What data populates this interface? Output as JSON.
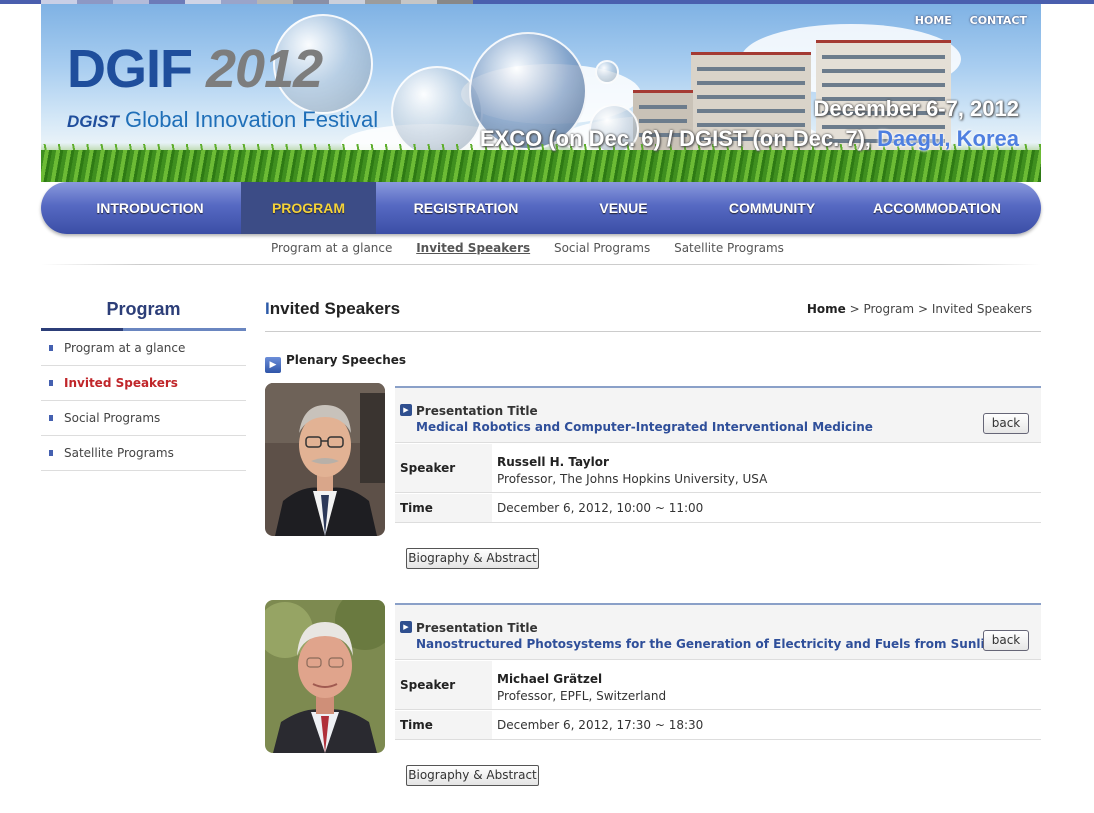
{
  "header": {
    "logo_title": "DGIF",
    "logo_year": "2012",
    "logo_org": "DGIST",
    "logo_subtitle": "Global Innovation Festival",
    "date": "December 6-7, 2012",
    "venue": "EXCO (on Dec. 6) / DGIST (on Dec. 7),",
    "city": "Daegu, Korea",
    "links": {
      "home": "HOME",
      "contact": "CONTACT"
    }
  },
  "nav": {
    "items": [
      "INTRODUCTION",
      "PROGRAM",
      "REGISTRATION",
      "VENUE",
      "COMMUNITY",
      "ACCOMMODATION"
    ],
    "active": "PROGRAM",
    "accent_color": "#f3d23a"
  },
  "subnav": {
    "items": [
      "Program at a glance",
      "Invited Speakers",
      "Social Programs",
      "Satellite Programs"
    ],
    "active": "Invited Speakers"
  },
  "sidebar": {
    "title": "Program",
    "items": [
      "Program at a glance",
      "Invited Speakers",
      "Social Programs",
      "Satellite Programs"
    ],
    "active": "Invited Speakers",
    "active_color": "#c0262a"
  },
  "content": {
    "title_first": "I",
    "title_rest": "nvited Speakers",
    "breadcrumb": {
      "home": "Home",
      "sep1": ">",
      "level1": "Program",
      "sep2": ">",
      "level2": "Invited Speakers"
    },
    "section": "Plenary Speeches",
    "labels": {
      "presentation_title": "Presentation Title",
      "speaker": "Speaker",
      "time": "Time",
      "back": "back",
      "bio": "Biography & Abstract"
    },
    "speakers": [
      {
        "title": "Medical Robotics and Computer-Integrated Interventional Medicine",
        "name": "Russell H. Taylor",
        "affiliation": "Professor, The Johns Hopkins University, USA",
        "time": "December 6, 2012, 10:00 ~ 11:00"
      },
      {
        "title": "Nanostructured Photosystems for the Generation of Electricity and Fuels from Sunlight",
        "name": "Michael Grätzel",
        "affiliation": "Professor, EPFL, Switzerland",
        "time": "December 6, 2012, 17:30 ~ 18:30"
      }
    ]
  }
}
